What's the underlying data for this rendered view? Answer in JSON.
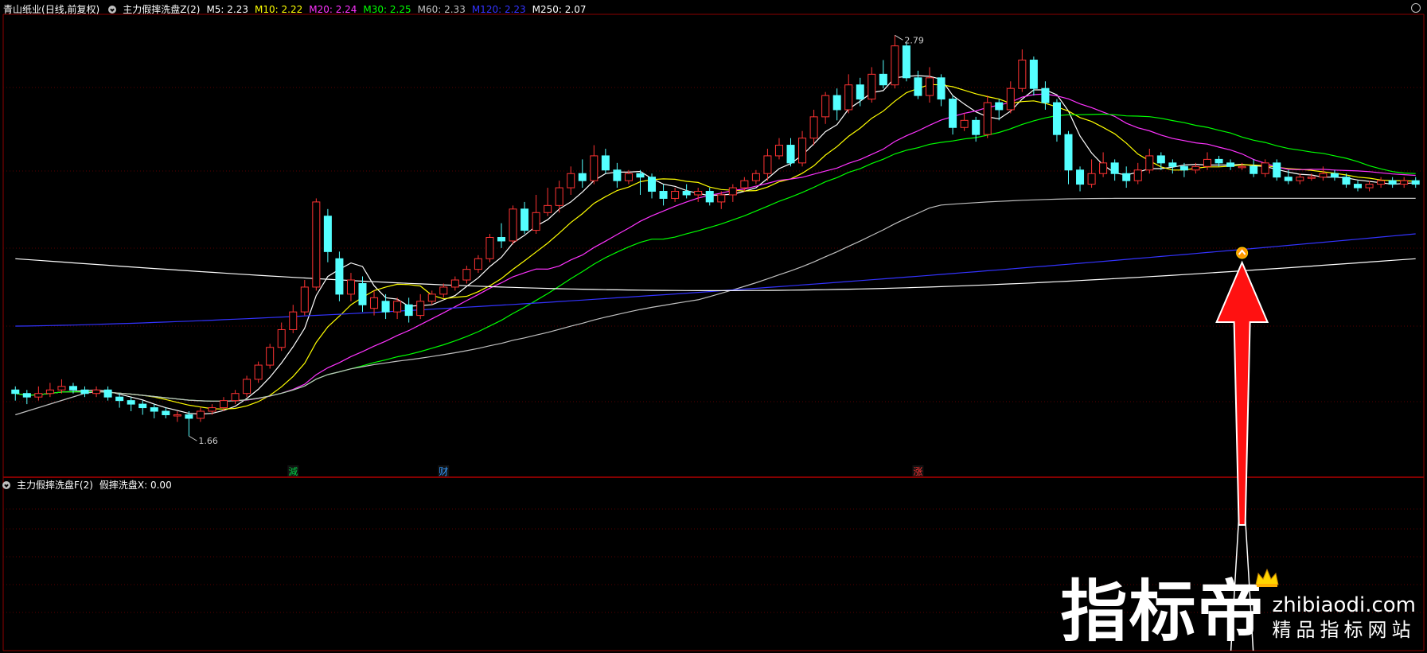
{
  "top_pane": {
    "stock_name": "青山纸业",
    "period_note": "(日线,前复权)",
    "indicator_name": "主力假摔洗盘Z(2)",
    "ma_labels": [
      {
        "text": "M5: 2.23",
        "color": "#ffffff"
      },
      {
        "text": "M10: 2.22",
        "color": "#ffff00"
      },
      {
        "text": "M20: 2.24",
        "color": "#ff33ff"
      },
      {
        "text": "M30: 2.25",
        "color": "#00ff00"
      },
      {
        "text": "M60: 2.33",
        "color": "#c0c0c0"
      },
      {
        "text": "M120: 2.23",
        "color": "#3333ff"
      },
      {
        "text": "M250: 2.07",
        "color": "#ffffff"
      }
    ],
    "high_label": "2.79",
    "low_label": "1.66",
    "signal_markers": [
      {
        "text": "減",
        "color": "#00cc44"
      },
      {
        "text": "财",
        "color": "#3399ff"
      },
      {
        "text": "涨",
        "color": "#ff3333"
      }
    ],
    "buy_marker_icon": "up-caret-circle-icon"
  },
  "bottom_pane": {
    "indicator_name": "主力假摔洗盘F(2)",
    "value_label": "假摔洗盘X: 0.00"
  },
  "annotation": {
    "arrow_color": "#ff1111",
    "arrow_icon": "up-arrow-icon"
  },
  "watermark": {
    "logo_text": "指标帝",
    "domain": "zhibiaodi.com",
    "slogan": "精品指标网站",
    "crown_icon": "crown-icon"
  },
  "chart_data": [
    {
      "type": "candlestick",
      "up_color": "#ff3333",
      "down_color": "#54ffff",
      "y_high": 2.79,
      "y_low": 1.66,
      "candles": [
        [
          1.79,
          1.78,
          1.8,
          1.76
        ],
        [
          1.78,
          1.77,
          1.79,
          1.75
        ],
        [
          1.77,
          1.78,
          1.8,
          1.76
        ],
        [
          1.78,
          1.79,
          1.81,
          1.77
        ],
        [
          1.79,
          1.8,
          1.82,
          1.78
        ],
        [
          1.8,
          1.79,
          1.81,
          1.78
        ],
        [
          1.79,
          1.78,
          1.8,
          1.77
        ],
        [
          1.78,
          1.79,
          1.8,
          1.77
        ],
        [
          1.79,
          1.77,
          1.8,
          1.76
        ],
        [
          1.77,
          1.76,
          1.78,
          1.74
        ],
        [
          1.76,
          1.75,
          1.77,
          1.73
        ],
        [
          1.75,
          1.74,
          1.76,
          1.72
        ],
        [
          1.74,
          1.73,
          1.75,
          1.71
        ],
        [
          1.73,
          1.72,
          1.74,
          1.71
        ],
        [
          1.72,
          1.72,
          1.73,
          1.7
        ],
        [
          1.72,
          1.71,
          1.73,
          1.66
        ],
        [
          1.71,
          1.73,
          1.74,
          1.7
        ],
        [
          1.73,
          1.74,
          1.75,
          1.72
        ],
        [
          1.74,
          1.76,
          1.77,
          1.73
        ],
        [
          1.76,
          1.78,
          1.79,
          1.75
        ],
        [
          1.78,
          1.82,
          1.83,
          1.77
        ],
        [
          1.82,
          1.86,
          1.87,
          1.81
        ],
        [
          1.86,
          1.91,
          1.92,
          1.85
        ],
        [
          1.91,
          1.96,
          1.98,
          1.9
        ],
        [
          1.96,
          2.01,
          2.03,
          1.95
        ],
        [
          2.01,
          2.08,
          2.1,
          2.0
        ],
        [
          2.08,
          2.32,
          2.33,
          2.07
        ],
        [
          2.28,
          2.18,
          2.3,
          2.15
        ],
        [
          2.16,
          2.06,
          2.18,
          2.04
        ],
        [
          2.06,
          2.1,
          2.12,
          2.04
        ],
        [
          2.09,
          2.03,
          2.11,
          2.01
        ],
        [
          2.02,
          2.05,
          2.07,
          2.0
        ],
        [
          2.04,
          2.01,
          2.06,
          1.99
        ],
        [
          2.01,
          2.04,
          2.05,
          1.99
        ],
        [
          2.03,
          2.0,
          2.05,
          1.98
        ],
        [
          2.0,
          2.04,
          2.06,
          1.99
        ],
        [
          2.04,
          2.06,
          2.07,
          2.03
        ],
        [
          2.06,
          2.08,
          2.09,
          2.05
        ],
        [
          2.08,
          2.1,
          2.11,
          2.07
        ],
        [
          2.1,
          2.13,
          2.14,
          2.09
        ],
        [
          2.13,
          2.16,
          2.17,
          2.12
        ],
        [
          2.16,
          2.22,
          2.23,
          2.15
        ],
        [
          2.22,
          2.21,
          2.26,
          2.19
        ],
        [
          2.21,
          2.3,
          2.31,
          2.2
        ],
        [
          2.3,
          2.24,
          2.32,
          2.23
        ],
        [
          2.24,
          2.29,
          2.34,
          2.23
        ],
        [
          2.29,
          2.31,
          2.36,
          2.28
        ],
        [
          2.31,
          2.36,
          2.38,
          2.29
        ],
        [
          2.36,
          2.4,
          2.42,
          2.34
        ],
        [
          2.4,
          2.38,
          2.44,
          2.36
        ],
        [
          2.38,
          2.45,
          2.48,
          2.37
        ],
        [
          2.45,
          2.41,
          2.47,
          2.4
        ],
        [
          2.41,
          2.38,
          2.43,
          2.36
        ],
        [
          2.38,
          2.4,
          2.41,
          2.37
        ],
        [
          2.4,
          2.39,
          2.41,
          2.34
        ],
        [
          2.39,
          2.35,
          2.4,
          2.33
        ],
        [
          2.35,
          2.33,
          2.37,
          2.31
        ],
        [
          2.33,
          2.35,
          2.36,
          2.32
        ],
        [
          2.35,
          2.34,
          2.37,
          2.33
        ],
        [
          2.34,
          2.35,
          2.36,
          2.32
        ],
        [
          2.35,
          2.32,
          2.36,
          2.31
        ],
        [
          2.32,
          2.34,
          2.35,
          2.3
        ],
        [
          2.34,
          2.36,
          2.37,
          2.32
        ],
        [
          2.36,
          2.38,
          2.39,
          2.35
        ],
        [
          2.38,
          2.4,
          2.41,
          2.37
        ],
        [
          2.4,
          2.45,
          2.47,
          2.38
        ],
        [
          2.45,
          2.48,
          2.5,
          2.44
        ],
        [
          2.48,
          2.43,
          2.5,
          2.42
        ],
        [
          2.43,
          2.5,
          2.52,
          2.42
        ],
        [
          2.5,
          2.56,
          2.58,
          2.48
        ],
        [
          2.56,
          2.62,
          2.63,
          2.54
        ],
        [
          2.62,
          2.58,
          2.64,
          2.55
        ],
        [
          2.58,
          2.65,
          2.68,
          2.57
        ],
        [
          2.65,
          2.61,
          2.67,
          2.59
        ],
        [
          2.61,
          2.68,
          2.7,
          2.6
        ],
        [
          2.68,
          2.65,
          2.72,
          2.64
        ],
        [
          2.65,
          2.76,
          2.79,
          2.64
        ],
        [
          2.76,
          2.67,
          2.77,
          2.66
        ],
        [
          2.67,
          2.62,
          2.69,
          2.61
        ],
        [
          2.62,
          2.67,
          2.7,
          2.6
        ],
        [
          2.67,
          2.61,
          2.68,
          2.59
        ],
        [
          2.61,
          2.53,
          2.62,
          2.51
        ],
        [
          2.53,
          2.55,
          2.57,
          2.52
        ],
        [
          2.55,
          2.51,
          2.56,
          2.49
        ],
        [
          2.51,
          2.6,
          2.62,
          2.5
        ],
        [
          2.6,
          2.58,
          2.61,
          2.55
        ],
        [
          2.58,
          2.64,
          2.66,
          2.57
        ],
        [
          2.64,
          2.72,
          2.75,
          2.63
        ],
        [
          2.72,
          2.64,
          2.73,
          2.62
        ],
        [
          2.64,
          2.6,
          2.66,
          2.58
        ],
        [
          2.6,
          2.51,
          2.61,
          2.49
        ],
        [
          2.51,
          2.41,
          2.52,
          2.37
        ],
        [
          2.41,
          2.37,
          2.42,
          2.35
        ],
        [
          2.37,
          2.4,
          2.44,
          2.36
        ],
        [
          2.4,
          2.43,
          2.46,
          2.39
        ],
        [
          2.43,
          2.4,
          2.44,
          2.38
        ],
        [
          2.4,
          2.38,
          2.42,
          2.36
        ],
        [
          2.38,
          2.41,
          2.43,
          2.37
        ],
        [
          2.41,
          2.45,
          2.47,
          2.4
        ],
        [
          2.45,
          2.43,
          2.46,
          2.41
        ],
        [
          2.43,
          2.42,
          2.44,
          2.4
        ],
        [
          2.42,
          2.41,
          2.43,
          2.39
        ],
        [
          2.41,
          2.42,
          2.43,
          2.4
        ],
        [
          2.42,
          2.44,
          2.46,
          2.41
        ],
        [
          2.44,
          2.43,
          2.45,
          2.42
        ],
        [
          2.43,
          2.42,
          2.44,
          2.41
        ],
        [
          2.42,
          2.42,
          2.43,
          2.41
        ],
        [
          2.42,
          2.4,
          2.44,
          2.39
        ],
        [
          2.4,
          2.43,
          2.44,
          2.39
        ],
        [
          2.43,
          2.39,
          2.44,
          2.38
        ],
        [
          2.39,
          2.38,
          2.41,
          2.37
        ],
        [
          2.38,
          2.39,
          2.4,
          2.37
        ],
        [
          2.39,
          2.39,
          2.4,
          2.38
        ],
        [
          2.39,
          2.4,
          2.42,
          2.38
        ],
        [
          2.4,
          2.39,
          2.41,
          2.38
        ],
        [
          2.39,
          2.37,
          2.4,
          2.36
        ],
        [
          2.37,
          2.36,
          2.38,
          2.35
        ],
        [
          2.36,
          2.37,
          2.38,
          2.35
        ],
        [
          2.37,
          2.38,
          2.39,
          2.36
        ],
        [
          2.38,
          2.37,
          2.39,
          2.36
        ],
        [
          2.37,
          2.38,
          2.39,
          2.36
        ],
        [
          2.38,
          2.37,
          2.39,
          2.36
        ]
      ]
    },
    {
      "type": "line",
      "series": [
        {
          "name": "M5",
          "color": "#ffffff"
        },
        {
          "name": "M10",
          "color": "#ffff00"
        },
        {
          "name": "M20",
          "color": "#ff33ff"
        },
        {
          "name": "M30",
          "color": "#00ff00"
        },
        {
          "name": "M60",
          "color": "#c0c0c0"
        },
        {
          "name": "M120",
          "color": "#3333ff"
        },
        {
          "name": "M250",
          "color": "#ffffff"
        }
      ]
    },
    {
      "type": "line",
      "series": [
        {
          "name": "假摔洗盘X",
          "color": "#ffffff"
        }
      ],
      "spike_value": 1,
      "baseline": 0
    }
  ]
}
